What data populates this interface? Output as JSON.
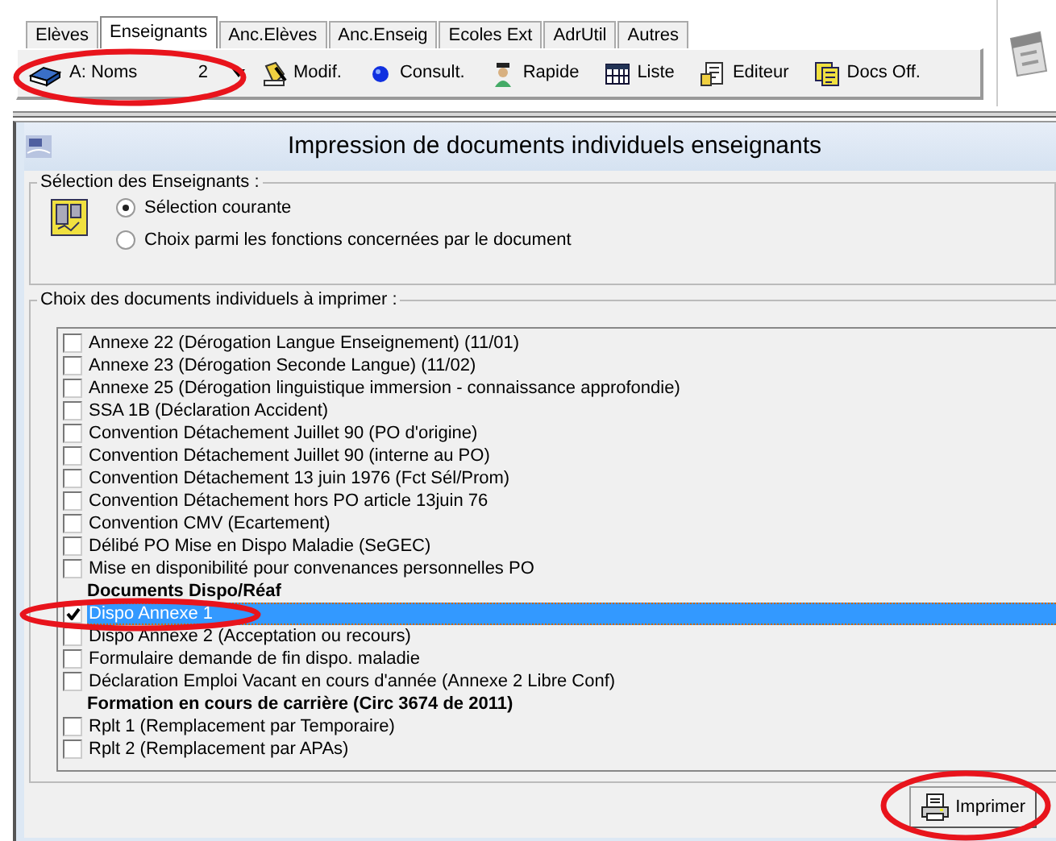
{
  "tabs": [
    {
      "label": "Elèves",
      "selected": false
    },
    {
      "label": "Enseignants",
      "selected": true
    },
    {
      "label": "Anc.Elèves",
      "selected": false
    },
    {
      "label": "Anc.Enseig",
      "selected": false
    },
    {
      "label": "Ecoles Ext",
      "selected": false
    },
    {
      "label": "AdrUtil",
      "selected": false
    },
    {
      "label": "Autres",
      "selected": false
    }
  ],
  "sort_combo": {
    "value": "A: Noms",
    "count": "2"
  },
  "toolbar": [
    {
      "kind": "edit",
      "label": "Modif."
    },
    {
      "kind": "view",
      "label": "Consult."
    },
    {
      "kind": "quick",
      "label": "Rapide"
    },
    {
      "kind": "list",
      "label": "Liste"
    },
    {
      "kind": "editor",
      "label": "Editeur"
    },
    {
      "kind": "docs",
      "label": "Docs Off."
    }
  ],
  "dialog": {
    "title": "Impression de documents individuels enseignants",
    "selection_group": {
      "title": "Sélection des Enseignants :",
      "options": [
        {
          "label": "Sélection courante",
          "selected": true
        },
        {
          "label": "Choix parmi les fonctions concernées par le document",
          "selected": false
        }
      ]
    },
    "documents_group": {
      "title": "Choix des documents individuels à imprimer :",
      "items": [
        {
          "kind": "check",
          "label": "Annexe 22 (Dérogation Langue Enseignement) (11/01)",
          "checked": false,
          "selected": false
        },
        {
          "kind": "check",
          "label": "Annexe 23 (Dérogation Seconde Langue) (11/02)",
          "checked": false,
          "selected": false
        },
        {
          "kind": "check",
          "label": "Annexe 25 (Dérogation linguistique immersion - connaissance approfondie)",
          "checked": false,
          "selected": false
        },
        {
          "kind": "check",
          "label": "SSA 1B (Déclaration Accident)",
          "checked": false,
          "selected": false
        },
        {
          "kind": "check",
          "label": "Convention Détachement Juillet 90 (PO d'origine)",
          "checked": false,
          "selected": false
        },
        {
          "kind": "check",
          "label": "Convention Détachement Juillet 90 (interne au PO)",
          "checked": false,
          "selected": false
        },
        {
          "kind": "check",
          "label": "Convention Détachement 13 juin 1976 (Fct Sél/Prom)",
          "checked": false,
          "selected": false
        },
        {
          "kind": "check",
          "label": "Convention Détachement hors PO article 13juin 76",
          "checked": false,
          "selected": false
        },
        {
          "kind": "check",
          "label": "Convention CMV (Ecartement)",
          "checked": false,
          "selected": false
        },
        {
          "kind": "check",
          "label": "Délibé PO Mise en Dispo Maladie (SeGEC)",
          "checked": false,
          "selected": false
        },
        {
          "kind": "check",
          "label": "Mise en disponibilité pour convenances personnelles PO",
          "checked": false,
          "selected": false
        },
        {
          "kind": "heading",
          "label": "Documents Dispo/Réaf"
        },
        {
          "kind": "check",
          "label": "Dispo Annexe 1",
          "checked": true,
          "selected": true
        },
        {
          "kind": "check",
          "label": "Dispo Annexe 2 (Acceptation ou recours)",
          "checked": false,
          "selected": false
        },
        {
          "kind": "check",
          "label": "Formulaire demande de fin dispo. maladie",
          "checked": false,
          "selected": false
        },
        {
          "kind": "check",
          "label": "Déclaration Emploi Vacant en cours d'année (Annexe 2 Libre Conf)",
          "checked": false,
          "selected": false
        },
        {
          "kind": "heading",
          "label": "Formation en cours de carrière (Circ 3674 de 2011)"
        },
        {
          "kind": "check",
          "label": "Rplt 1 (Remplacement par Temporaire)",
          "checked": false,
          "selected": false
        },
        {
          "kind": "check",
          "label": "Rplt 2 (Remplacement par APAs)",
          "checked": false,
          "selected": false
        }
      ]
    },
    "print_button": "Imprimer"
  },
  "annotations": [
    {
      "kind": "ellipse"
    },
    {
      "kind": "ellipse"
    },
    {
      "kind": "ellipse"
    }
  ]
}
